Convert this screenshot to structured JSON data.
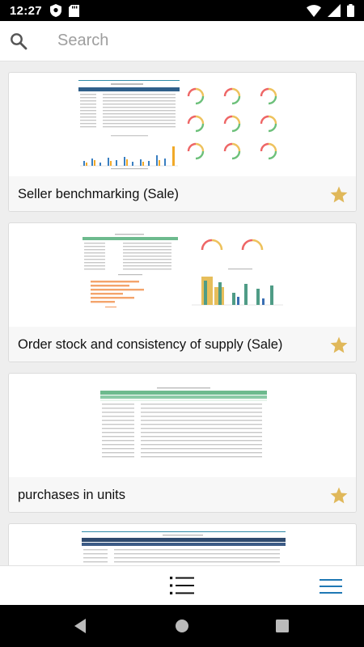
{
  "status_bar": {
    "time": "12:27",
    "icons": [
      "shield-icon",
      "sd-card-icon",
      "wifi-icon",
      "signal-icon",
      "battery-icon"
    ]
  },
  "search": {
    "placeholder": "Search",
    "value": ""
  },
  "reports": [
    {
      "title": "Seller benchmarking (Sale)",
      "favorite": true
    },
    {
      "title": "Order stock and consistency of supply (Sale)",
      "favorite": true
    },
    {
      "title": "purchases in units",
      "favorite": true
    },
    {
      "title": "",
      "favorite": false
    }
  ],
  "bottom_bar": {
    "icons": [
      "list-view-icon",
      "menu-icon"
    ]
  },
  "colors": {
    "accent": "#1f78b4",
    "star": "#e0b85a",
    "table_header_green": "#6dba8e",
    "table_header_navy": "#2f4a6e"
  }
}
